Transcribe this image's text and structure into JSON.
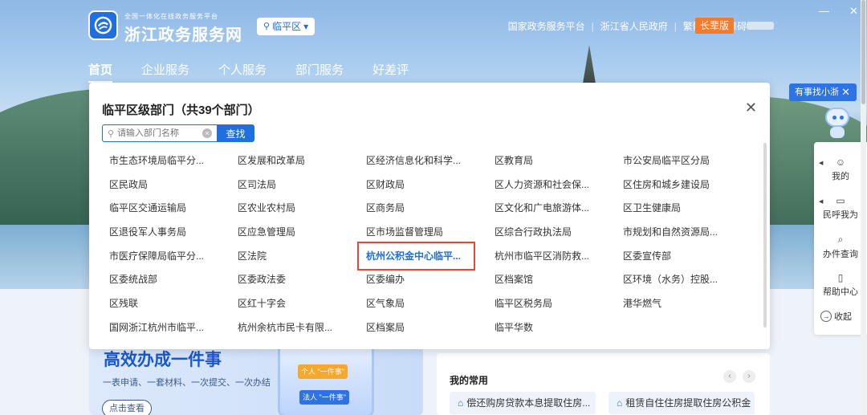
{
  "header": {
    "logo_sub": "全国一体化在线政务服务平台",
    "logo_title": "浙江政务服务网",
    "region": "临平区",
    "links": [
      "国家政务服务平台",
      "浙江省人民政府",
      "繁體",
      "无障碍"
    ],
    "elder_mode": "长辈版"
  },
  "nav": {
    "items": [
      "首页",
      "企业服务",
      "个人服务",
      "部门服务",
      "好差评"
    ]
  },
  "modal": {
    "title": "临平区级部门（共39个部门）",
    "search_placeholder": "请输入部门名称",
    "search_button": "查找",
    "departments": [
      "市生态环境局临平分...",
      "区发展和改革局",
      "区经济信息化和科学...",
      "区教育局",
      "市公安局临平区分局",
      "区民政局",
      "区司法局",
      "区财政局",
      "区人力资源和社会保...",
      "区住房和城乡建设局",
      "临平区交通运输局",
      "区农业农村局",
      "区商务局",
      "区文化和广电旅游体...",
      "区卫生健康局",
      "区退役军人事务局",
      "区应急管理局",
      "区市场监督管理局",
      "区综合行政执法局",
      "市规划和自然资源局...",
      "市医疗保障局临平分...",
      "区法院",
      "杭州公积金中心临平...",
      "杭州市临平区消防救...",
      "区委宣传部",
      "区委统战部",
      "区委政法委",
      "区委编办",
      "区档案馆",
      "区环境（水务）控股...",
      "区残联",
      "区红十字会",
      "区气象局",
      "临平区税务局",
      "港华燃气",
      "国网浙江杭州市临平...",
      "杭州余杭市民卡有限...",
      "区档案局",
      "临平华数"
    ],
    "highlighted_index": 22
  },
  "promo": {
    "title": "高效办成一件事",
    "subtitle": "一表申请、一套材料、一次提交、一次办结",
    "button": "点击查看",
    "tag_personal": "个人 \"一件事\"",
    "tag_corporate": "法人 \"一件事\""
  },
  "usual": {
    "title": "我的常用",
    "items": [
      "偿还购房贷款本息提取住房...",
      "租赁自住住房提取住房公积金"
    ]
  },
  "assistant": {
    "bubble": "有事找小浙",
    "side_items": [
      "我的",
      "民呼我为",
      "办件查询",
      "帮助中心"
    ],
    "collapse": "收起"
  }
}
